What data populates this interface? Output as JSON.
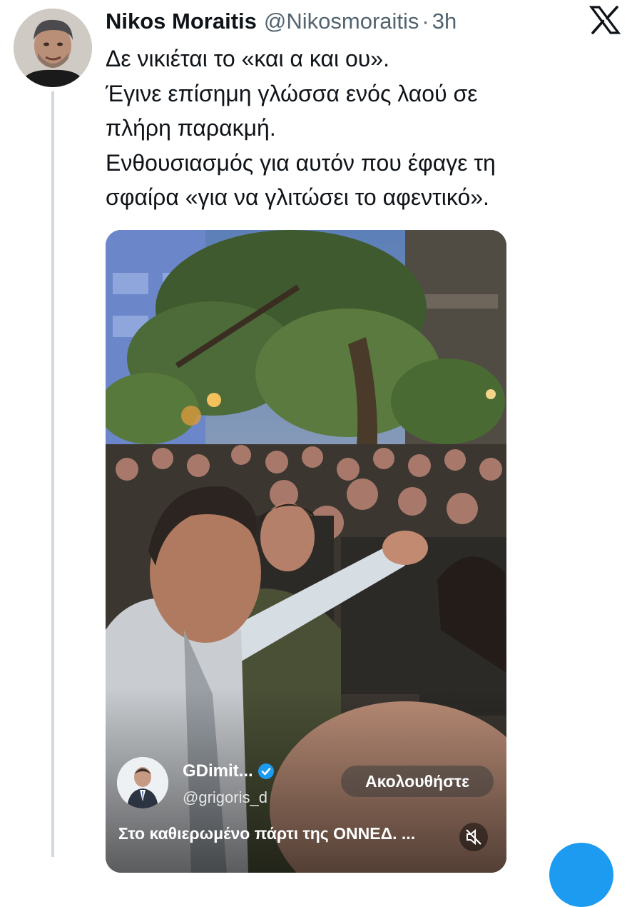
{
  "tweet": {
    "author_name": "Nikos Moraitis",
    "author_handle": "@Nikosmoraitis",
    "separator": "·",
    "time": "3h",
    "text_lines": [
      "Δε νικιέται το «και α και ου».",
      "Έγινε επίσημη γλώσσα ενός λαού σε",
      "πλήρη παρακμή.",
      "Ενθουσιασμός για αυτόν που έφαγε τη",
      "σφαίρα «για να γλιτώσει το αφεντικό»."
    ],
    "avatar_icon": "profile-photo",
    "platform_icon": "x-logo-icon"
  },
  "video": {
    "embed_name": "GDimit...",
    "embed_handle": "@grigoris_d",
    "follow_label": "Ακολουθήστε",
    "caption": "Στο καθιερωμένο πάρτι της ΟΝΝΕΔ. ...",
    "mute_icon": "muted-speaker-icon",
    "verified_icon": "verified-badge-icon"
  },
  "colors": {
    "text": "#0f1419",
    "secondary": "#536471",
    "thread_line": "#cfd9de",
    "accent": "#1d9bf0"
  }
}
